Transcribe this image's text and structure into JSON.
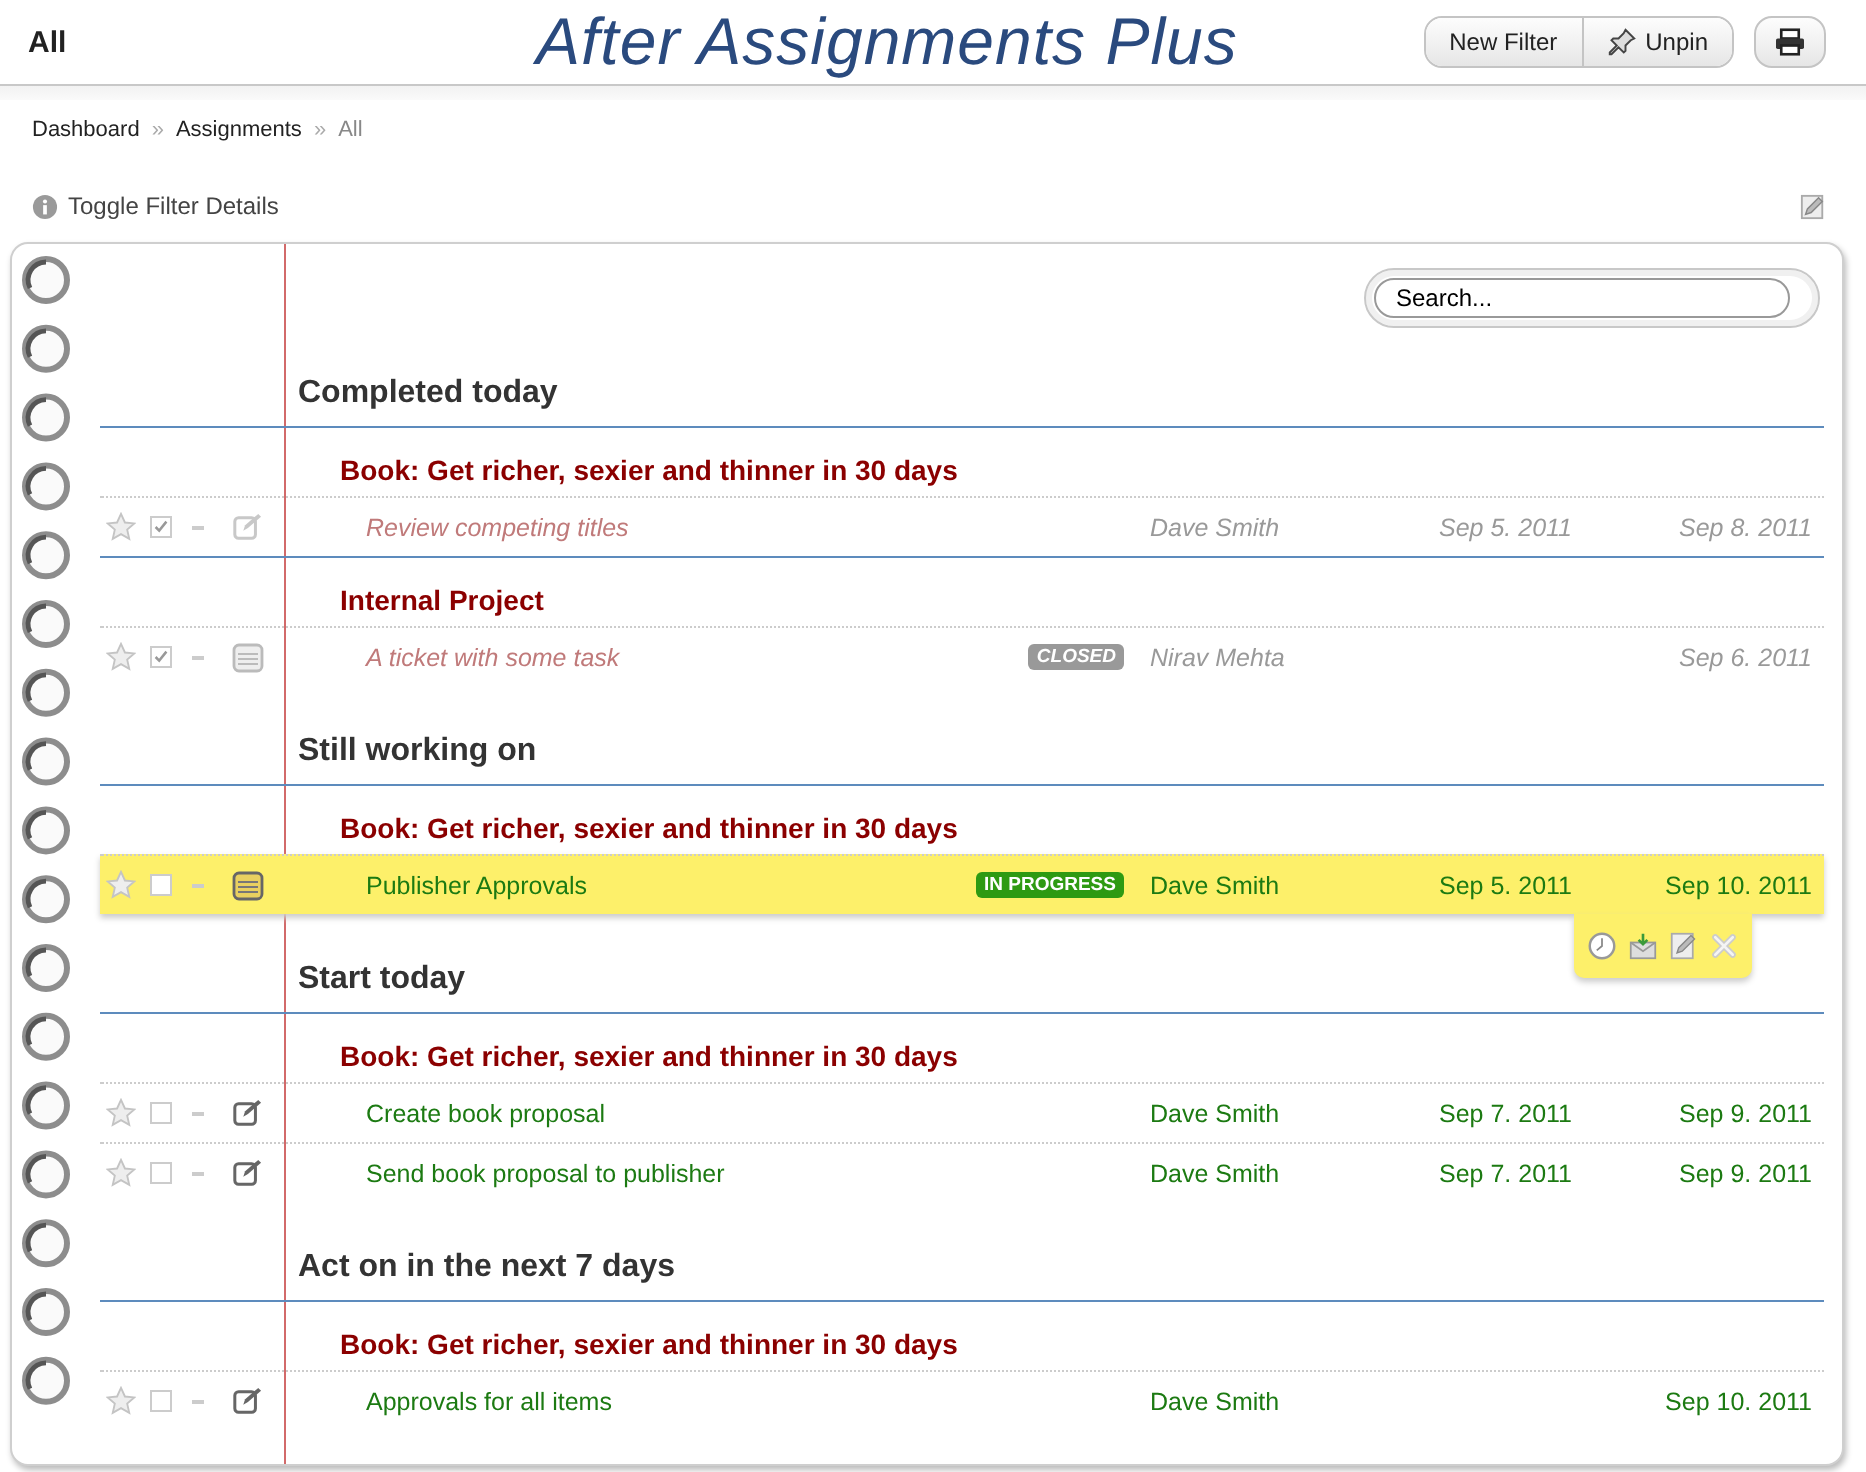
{
  "header": {
    "title": "All",
    "banner": "After Assignments Plus",
    "buttons": [
      {
        "kind": "text",
        "label": "New Filter"
      },
      {
        "kind": "pin",
        "label": "Unpin"
      }
    ]
  },
  "breadcrumb": {
    "separator": "»",
    "items": [
      {
        "label": "Dashboard",
        "current": false
      },
      {
        "label": "Assignments",
        "current": false
      },
      {
        "label": "All",
        "current": true
      }
    ]
  },
  "filter_toggle": {
    "label": "Toggle Filter Details"
  },
  "search": {
    "value": "Search..."
  },
  "sections": [
    {
      "title": "Completed today",
      "groups": [
        {
          "project": "Book: Get richer, sexier and thinner in 30 days",
          "tasks": [
            {
              "kind": "task",
              "name": "Review competing titles",
              "starred": false,
              "checked": true,
              "selected": false,
              "assignee": "Dave Smith",
              "start": "Sep 5. 2011",
              "due": "Sep 8. 2011"
            }
          ]
        },
        {
          "project": "Internal Project",
          "tasks": [
            {
              "kind": "ticket",
              "name": "A ticket with some task",
              "starred": false,
              "checked": true,
              "selected": false,
              "badge": {
                "label": "CLOSED",
                "color": "#999999"
              },
              "assignee": "Nirav Mehta",
              "due": "Sep 6. 2011"
            }
          ]
        }
      ]
    },
    {
      "title": "Still working on",
      "groups": [
        {
          "project": "Book: Get richer, sexier and thinner in 30 days",
          "tasks": [
            {
              "kind": "ticket",
              "name": "Publisher Approvals",
              "starred": false,
              "checked": false,
              "selected": true,
              "badge": {
                "label": "IN PROGRESS",
                "color": "#2e9a12"
              },
              "assignee": "Dave Smith",
              "start": "Sep 5. 2011",
              "due": "Sep 10. 2011"
            }
          ]
        }
      ]
    },
    {
      "title": "Start today",
      "groups": [
        {
          "project": "Book: Get richer, sexier and thinner in 30 days",
          "tasks": [
            {
              "kind": "task",
              "name": "Create book proposal",
              "starred": false,
              "checked": false,
              "selected": false,
              "assignee": "Dave Smith",
              "start": "Sep 7. 2011",
              "due": "Sep 9. 2011"
            },
            {
              "kind": "task",
              "name": "Send book proposal to publisher",
              "starred": false,
              "checked": false,
              "selected": false,
              "assignee": "Dave Smith",
              "start": "Sep 7. 2011",
              "due": "Sep 9. 2011"
            }
          ]
        }
      ]
    },
    {
      "title": "Act on in the next 7 days",
      "groups": [
        {
          "project": "Book: Get richer, sexier and thinner in 30 days",
          "tasks": [
            {
              "kind": "task",
              "name": "Approvals for all items",
              "starred": false,
              "checked": false,
              "selected": false,
              "assignee": "Dave Smith",
              "due": "Sep 10. 2011"
            }
          ]
        }
      ]
    }
  ]
}
